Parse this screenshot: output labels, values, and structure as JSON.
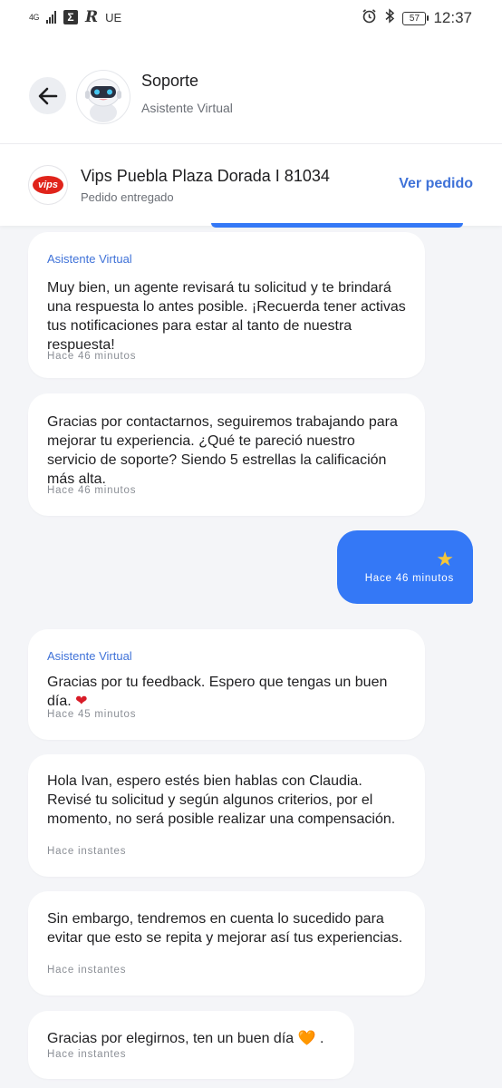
{
  "status_bar": {
    "network": "4G",
    "sigma_icon": "Σ",
    "r_icon": "R",
    "carrier": "UE",
    "battery": "57",
    "time": "12:37"
  },
  "header": {
    "title": "Soporte",
    "subtitle": "Asistente Virtual"
  },
  "order": {
    "logo_text": "vips",
    "title": "Vips Puebla Plaza Dorada I 81034",
    "status": "Pedido entregado",
    "link": "Ver pedido"
  },
  "messages": [
    {
      "sender": "Asistente Virtual",
      "text": "Muy bien, un agente revisará tu solicitud y te brindará una respuesta lo antes posible. ¡Recuerda tener activas tus notificaciones para estar al tanto de nuestra respuesta!",
      "time": "Hace 46 minutos"
    },
    {
      "text": "Gracias por contactarnos, seguiremos trabajando para mejorar tu experiencia. ¿Qué te pareció nuestro servicio de soporte? Siendo 5 estrellas la calificación más alta.",
      "time": "Hace 46 minutos"
    },
    {
      "outgoing": true,
      "rating_stars": 1,
      "star": "★",
      "time": "Hace 46 minutos"
    },
    {
      "sender": "Asistente Virtual",
      "text": "Gracias por tu feedback. Espero que tengas un buen día.",
      "emoji": "❤",
      "time": "Hace 45 minutos"
    },
    {
      "text": "Hola Ivan, espero estés bien hablas con Claudia. Revisé tu solicitud y según algunos criterios, por el momento, no será posible realizar una compensación.",
      "time": "Hace instantes"
    },
    {
      "text": "Sin embargo, tendremos en cuenta lo sucedido para evitar que esto se repita y mejorar así tus experiencias.",
      "time": "Hace instantes"
    },
    {
      "text": "Gracias por elegirnos, ten un buen día",
      "emoji": "🧡",
      "trailing": " .",
      "time": "Hace instantes"
    }
  ],
  "colors": {
    "accent": "#3f72d8",
    "sent_bubble": "#3478f6",
    "background": "#f4f5f8",
    "brand_red": "#e0241b"
  }
}
